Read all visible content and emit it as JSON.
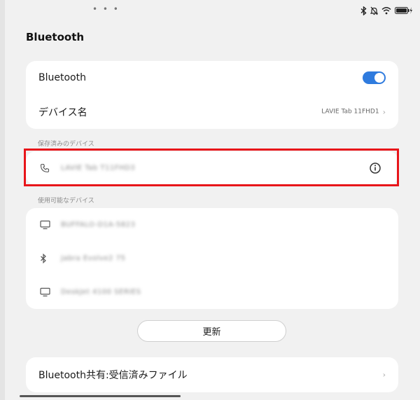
{
  "status_bar": {
    "dots": "• • •",
    "icons": [
      "bluetooth-icon",
      "mute-icon",
      "wifi-icon",
      "battery-icon"
    ]
  },
  "page": {
    "title": "Bluetooth"
  },
  "settings": {
    "bluetooth_label": "Bluetooth",
    "bluetooth_enabled": true,
    "device_name_label": "デバイス名",
    "device_name_value": "LAVIE Tab 11FHD1"
  },
  "saved_devices": {
    "header": "保存済みのデバイス",
    "items": [
      {
        "name": "LAVIE Tab T11FHD3",
        "icon": "phone-icon"
      }
    ]
  },
  "available_devices": {
    "header": "使用可能なデバイス",
    "items": [
      {
        "name": "BUFFALO-D1A-5823",
        "icon": "monitor-icon"
      },
      {
        "name": "Jabra Evolve2 75",
        "icon": "bluetooth-icon"
      },
      {
        "name": "DeskJet 4100 SERIES",
        "icon": "monitor-icon"
      }
    ]
  },
  "refresh_button": "更新",
  "share": {
    "label": "Bluetooth共有:受信済みファイル"
  },
  "colors": {
    "accent": "#2f7bde",
    "highlight": "#e8151a",
    "background": "#f1f1f1"
  }
}
